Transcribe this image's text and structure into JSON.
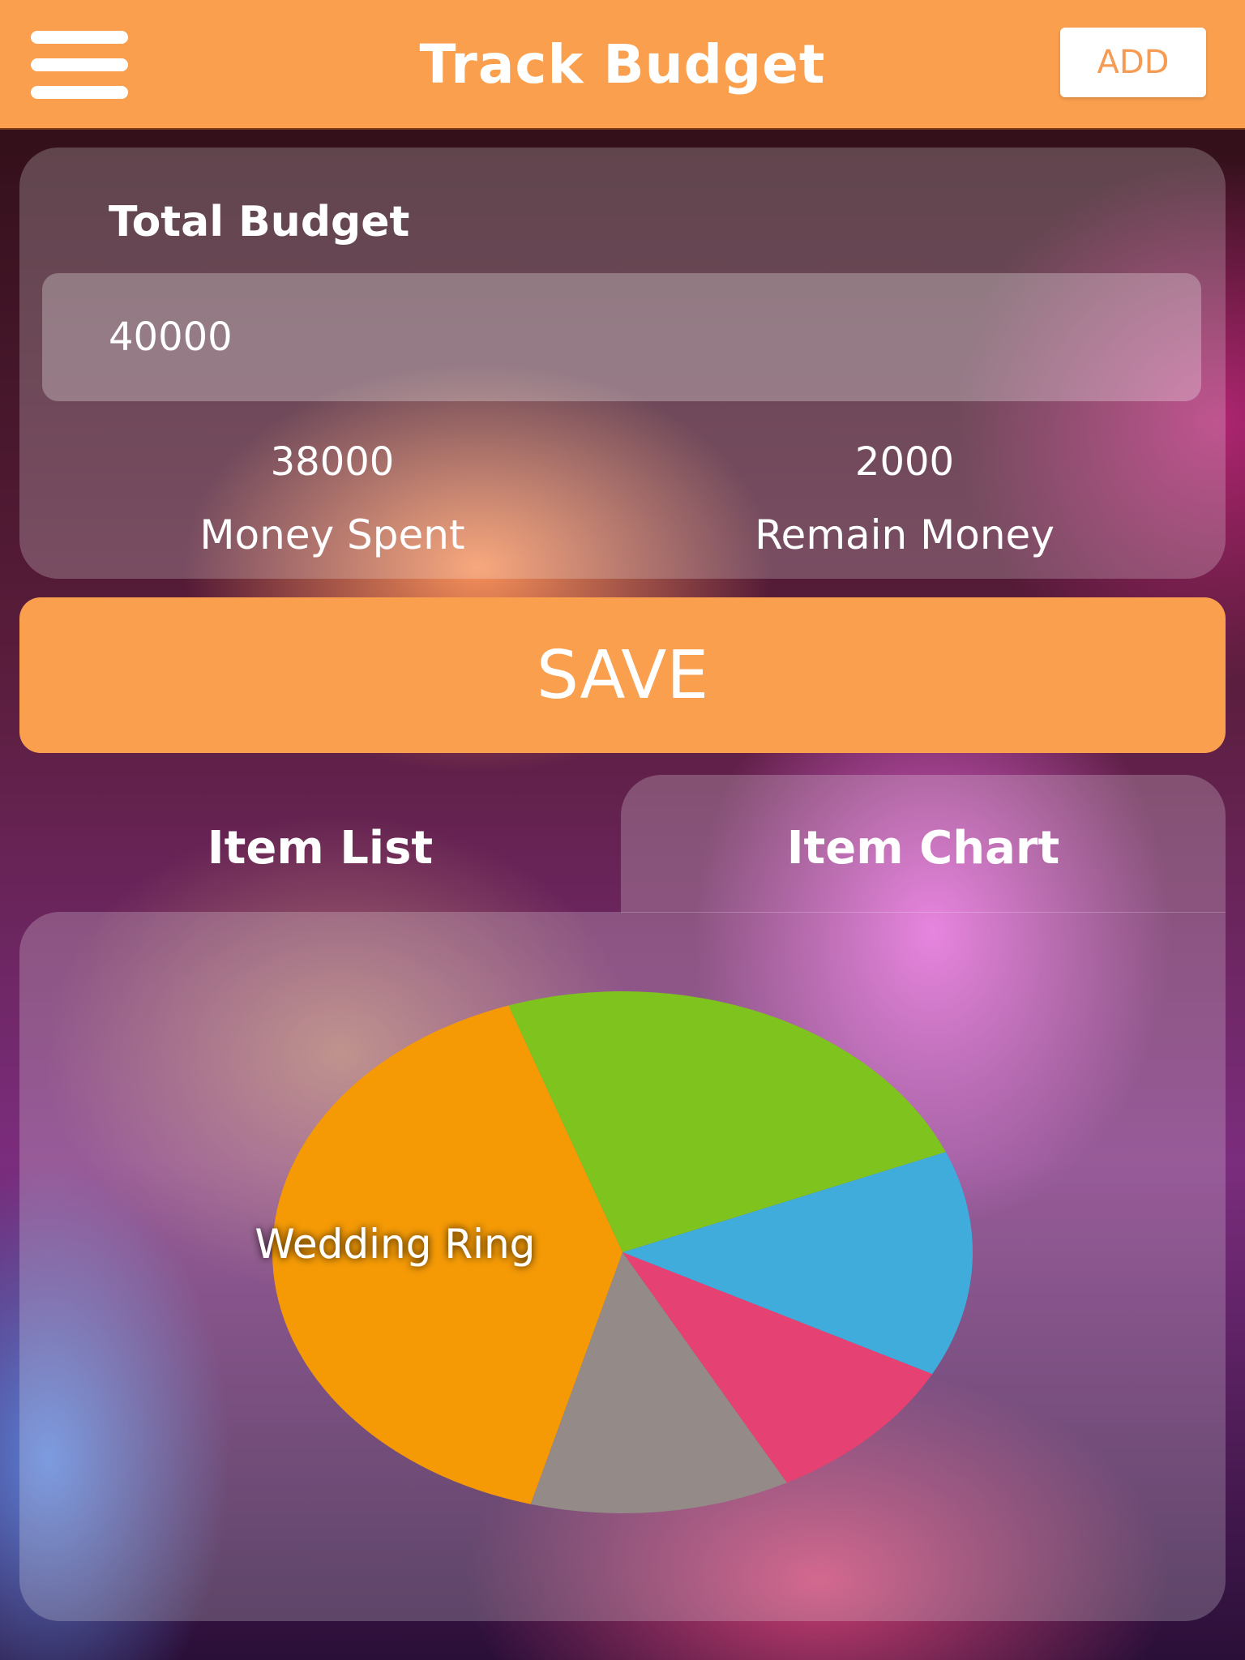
{
  "header": {
    "title": "Track Budget",
    "add_label": "ADD",
    "menu_icon": "hamburger-menu-icon",
    "background_color": "#f99f4d"
  },
  "budget": {
    "label": "Total Budget",
    "value": "40000",
    "spent_value": "38000",
    "spent_label": "Money Spent",
    "remain_value": "2000",
    "remain_label": "Remain Money"
  },
  "save_label": "SAVE",
  "tabs": [
    {
      "label": "Item List",
      "selected": false
    },
    {
      "label": "Item Chart",
      "selected": true
    }
  ],
  "chart_data": {
    "type": "pie",
    "labels": [
      "",
      "",
      "",
      "",
      "Wedding Ring"
    ],
    "values": [
      24,
      14,
      9.5,
      12,
      40.5
    ],
    "colors": [
      "#7ec31e",
      "#40acdb",
      "#e54172",
      "#948a87",
      "#f59a05"
    ],
    "start_angle_deg": 251,
    "direction": "clockwise"
  }
}
